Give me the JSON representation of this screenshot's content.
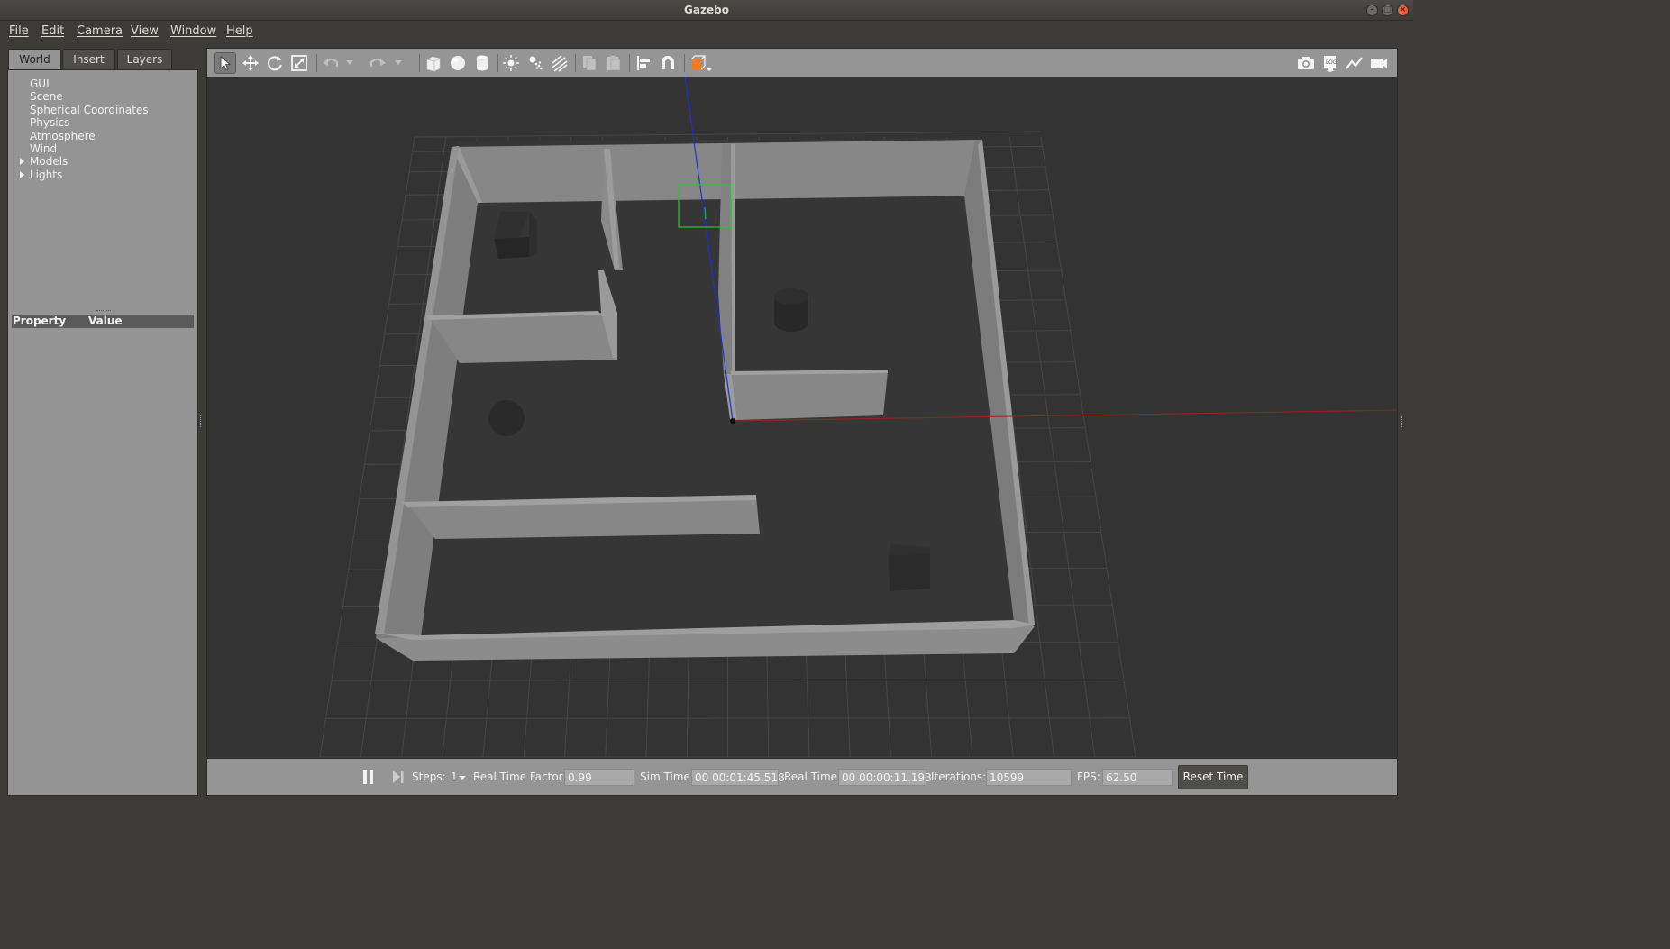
{
  "window": {
    "title": "Gazebo",
    "minimize_icon": "–",
    "maximize_icon": "□",
    "close_icon": "×"
  },
  "menu": [
    "File",
    "Edit",
    "Camera",
    "View",
    "Window",
    "Help"
  ],
  "left_panel": {
    "tabs": [
      "World",
      "Insert",
      "Layers"
    ],
    "active_tab": "World",
    "tree": [
      {
        "label": "GUI",
        "expandable": false
      },
      {
        "label": "Scene",
        "expandable": false
      },
      {
        "label": "Spherical Coordinates",
        "expandable": false
      },
      {
        "label": "Physics",
        "expandable": false
      },
      {
        "label": "Atmosphere",
        "expandable": false
      },
      {
        "label": "Wind",
        "expandable": false
      },
      {
        "label": "Models",
        "expandable": true
      },
      {
        "label": "Lights",
        "expandable": true
      }
    ],
    "property_header": {
      "property": "Property",
      "value": "Value"
    }
  },
  "toolbar": {
    "tools": [
      "select-tool",
      "translate-tool",
      "rotate-tool",
      "scale-tool",
      "undo",
      "undo-history",
      "redo",
      "redo-history",
      "box-shape",
      "sphere-shape",
      "cylinder-shape",
      "point-light",
      "spot-light",
      "directional-light",
      "copy",
      "paste",
      "align",
      "snap",
      "view-angle"
    ],
    "right_tools": [
      "screenshot",
      "log",
      "plot",
      "video-record"
    ]
  },
  "bottom_bar": {
    "steps_label": "Steps:",
    "steps_value": "1",
    "rtf_label": "Real Time Factor:",
    "rtf_value": "0.99",
    "sim_time_label": "Sim Time:",
    "sim_time_value": "00 00:01:45.518",
    "real_time_label": "Real Time:",
    "real_time_value": "00 00:00:11.193",
    "iterations_label": "Iterations:",
    "iterations_value": "10599",
    "fps_label": "FPS:",
    "fps_value": "62.50",
    "reset_label": "Reset Time"
  },
  "colors": {
    "viewport_bg": "#333333",
    "wall_top": "#8e8e8e",
    "wall_side": "#6f6f6f",
    "grid": "#474747",
    "x_axis": "#b22222",
    "z_axis": "#1f2fd6",
    "selection": "#22cc22",
    "accent": "#e8613f"
  }
}
